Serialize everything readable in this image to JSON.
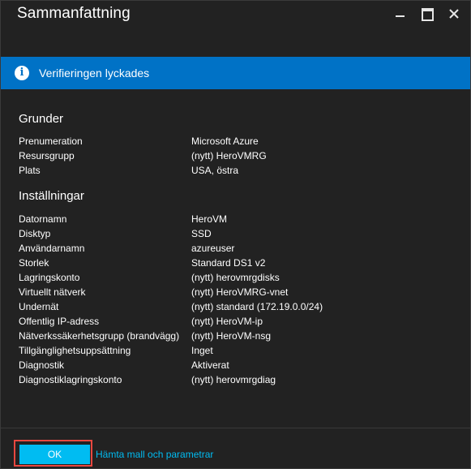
{
  "blade": {
    "title": "Sammanfattning"
  },
  "window_controls": {
    "icons": [
      "minimize-icon",
      "maximize-icon",
      "close-icon"
    ]
  },
  "notification": {
    "text": "Verifieringen lyckades",
    "icon": "info-icon",
    "icon_glyph": "i",
    "color": "#0072c6"
  },
  "sections": [
    {
      "heading": "Grunder",
      "rows": [
        {
          "key": "Prenumeration",
          "value": "Microsoft Azure"
        },
        {
          "key": "Resursgrupp",
          "value": "(nytt) HeroVMRG"
        },
        {
          "key": "Plats",
          "value": "USA, östra"
        }
      ]
    },
    {
      "heading": "Inställningar",
      "rows": [
        {
          "key": "Datornamn",
          "value": "HeroVM"
        },
        {
          "key": "Disktyp",
          "value": "SSD"
        },
        {
          "key": "Användarnamn",
          "value": "azureuser"
        },
        {
          "key": "Storlek",
          "value": "Standard DS1 v2"
        },
        {
          "key": "Lagringskonto",
          "value": "(nytt) herovmrgdisks"
        },
        {
          "key": "Virtuellt nätverk",
          "value": "(nytt) HeroVMRG-vnet"
        },
        {
          "key": "Undernät",
          "value": "(nytt) standard (172.19.0.0/24)"
        },
        {
          "key": "Offentlig IP-adress",
          "value": "(nytt) HeroVM-ip"
        },
        {
          "key": "Nätverkssäkerhetsgrupp (brandvägg)",
          "value": "(nytt) HeroVM-nsg"
        },
        {
          "key": "Tillgänglighetsuppsättning",
          "value": "Inget"
        },
        {
          "key": "Diagnostik",
          "value": "Aktiverat"
        },
        {
          "key": "Diagnostiklagringskonto",
          "value": "(nytt) herovmrgdiag"
        }
      ]
    }
  ],
  "footer": {
    "ok_label": "OK",
    "template_link": "Hämta mall och parametrar"
  },
  "colors": {
    "background": "#222222",
    "accent": "#00bcf2",
    "highlight_border": "#e8473f"
  }
}
